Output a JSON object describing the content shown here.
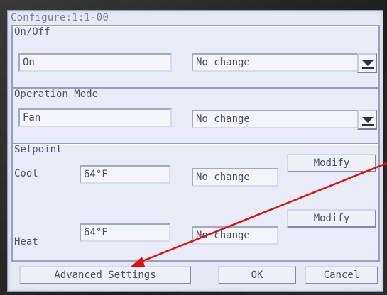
{
  "title": "Configure:1:1-00",
  "on_off": {
    "section_label": "On/Off",
    "current_value": "On",
    "selector_value": "No change",
    "dropdown_icon": "chevron-down-icon"
  },
  "operation_mode": {
    "section_label": "Operation Mode",
    "current_value": "Fan",
    "selector_value": "No change",
    "dropdown_icon": "chevron-down-icon"
  },
  "setpoint": {
    "section_label": "Setpoint",
    "cool": {
      "label": "Cool",
      "current_value": "64°F",
      "new_value": "No change",
      "modify_label": "Modify"
    },
    "heat": {
      "label": "Heat",
      "current_value": "64°F",
      "new_value": "No change",
      "modify_label": "Modify"
    }
  },
  "footer": {
    "advanced_settings_label": "Advanced Settings",
    "ok_label": "OK",
    "cancel_label": "Cancel"
  },
  "annotation": {
    "arrow_color": "#e01010"
  }
}
